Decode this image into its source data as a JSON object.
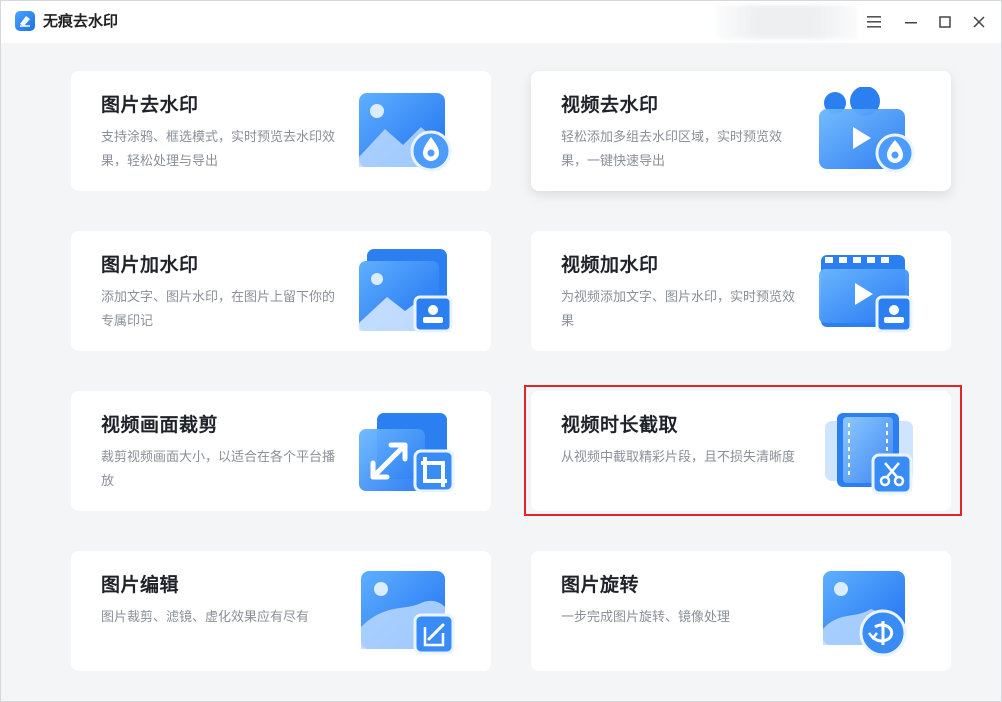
{
  "app": {
    "title": "无痕去水印"
  },
  "window_controls": {
    "menu_icon": "menu-icon",
    "minimize_icon": "minimize-icon",
    "maximize_icon": "maximize-icon",
    "close_icon": "close-icon"
  },
  "cards": [
    {
      "title": "图片去水印",
      "desc": "支持涂鸦、框选模式，实时预览去水印效果，轻松处理与导出",
      "icon": "image-remove-watermark-icon"
    },
    {
      "title": "视频去水印",
      "desc": "轻松添加多组去水印区域，实时预览效果，一键快速导出",
      "icon": "video-remove-watermark-icon"
    },
    {
      "title": "图片加水印",
      "desc": "添加文字、图片水印，在图片上留下你的专属印记",
      "icon": "image-add-watermark-icon"
    },
    {
      "title": "视频加水印",
      "desc": "为视频添加文字、图片水印，实时预览效果",
      "icon": "video-add-watermark-icon"
    },
    {
      "title": "视频画面裁剪",
      "desc": "裁剪视频画面大小，以适合在各个平台播放",
      "icon": "video-crop-icon"
    },
    {
      "title": "视频时长截取",
      "desc": "从视频中截取精彩片段，且不损失清晰度",
      "icon": "video-trim-icon"
    },
    {
      "title": "图片编辑",
      "desc": "图片裁剪、滤镜、虚化效果应有尽有",
      "icon": "image-edit-icon"
    },
    {
      "title": "图片旋转",
      "desc": "一步完成图片旋转、镜像处理",
      "icon": "image-rotate-icon"
    }
  ],
  "colors": {
    "accent": "#2f80f5",
    "highlight": "#e0262a",
    "title_text": "#1f2329",
    "desc_text": "#8a8f99"
  }
}
